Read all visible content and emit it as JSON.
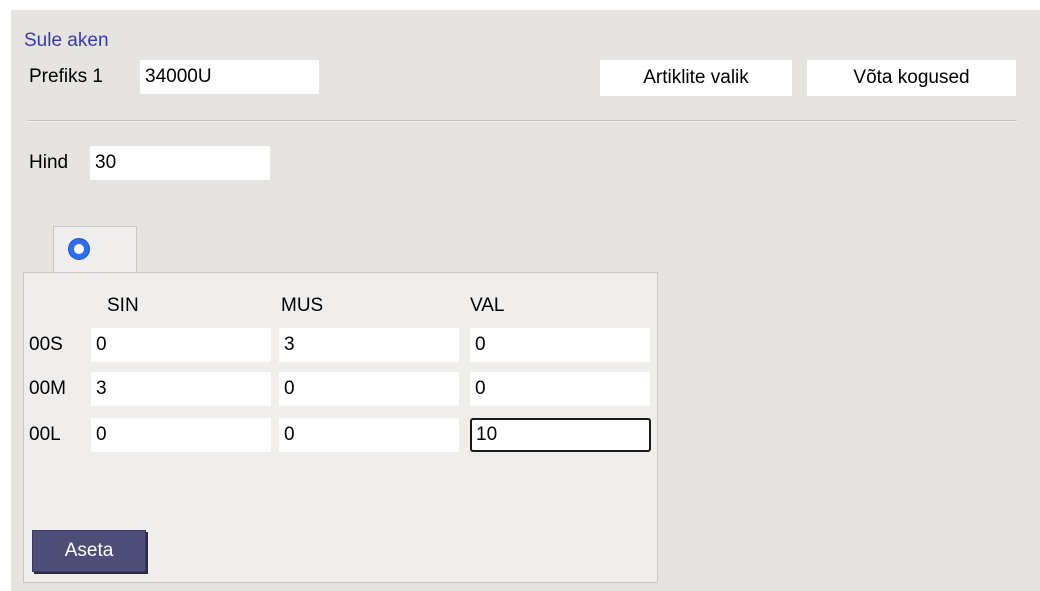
{
  "header": {
    "close_link": "Sule aken",
    "prefix_label": "Prefiks 1",
    "prefix_value": "34000U",
    "select_items_button": "Artiklite valik",
    "take_quantities_button": "Võta kogused"
  },
  "price": {
    "label": "Hind",
    "value": "30"
  },
  "matrix": {
    "columns": [
      "SIN",
      "MUS",
      "VAL"
    ],
    "rows": [
      {
        "label": "00S",
        "values": [
          "0",
          "3",
          "0"
        ]
      },
      {
        "label": "00M",
        "values": [
          "3",
          "0",
          "0"
        ]
      },
      {
        "label": "00L",
        "values": [
          "0",
          "0",
          "10"
        ]
      }
    ],
    "apply_button": "Aseta"
  },
  "colors": {
    "panel_bg": "#e6e4e1",
    "link": "#3a39a8",
    "apply_button_bg": "#4d4d78",
    "radio_selected": "#2d6ee8"
  }
}
